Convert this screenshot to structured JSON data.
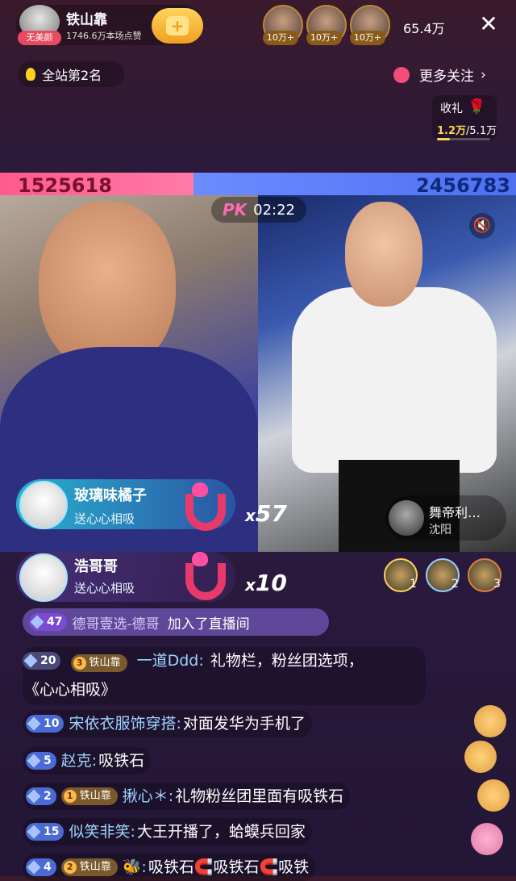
{
  "header": {
    "host_name": "铁山靠",
    "host_badge": "无美颜",
    "host_likes": "1746.6万本场点赞",
    "follow_symbol": "+",
    "top_fans": [
      {
        "label": "10万+"
      },
      {
        "label": "10万+"
      },
      {
        "label": "10万+"
      }
    ],
    "viewers": "65.4万",
    "close_symbol": "✕"
  },
  "subheader": {
    "rank_text": "全站第2名",
    "more_follow": "更多关注",
    "more_follow_arrow": "›",
    "gift_title": "收礼",
    "gift_current": "1.2万",
    "gift_target": "/5.1万"
  },
  "pk": {
    "left_score": "1525618",
    "right_score": "2456783",
    "logo": "PK",
    "timer": "02:22",
    "mute_symbol": "🔇"
  },
  "combos": [
    {
      "name": "玻璃味橘子",
      "action": "送心心相吸",
      "mult_prefix": "x",
      "mult": "57"
    },
    {
      "name": "浩哥哥",
      "action": "送心心相吸",
      "mult_prefix": "x",
      "mult": "10"
    }
  ],
  "remote_host": {
    "name": "舞帝利…",
    "city": "沈阳"
  },
  "ranking": [
    {
      "num": "1"
    },
    {
      "num": "2"
    },
    {
      "num": "3"
    }
  ],
  "join_message": {
    "level": "47",
    "user": "德哥壹选-德哥",
    "text": "加入了直播间"
  },
  "chat": [
    {
      "level": "20",
      "fan_num": "3",
      "fan_tag": "铁山靠",
      "user": "一道Ddd:",
      "msg_line1": "礼物栏，粉丝团选项，",
      "msg_line2": "《心心相吸》"
    },
    {
      "level": "10",
      "user": "宋依衣服饰穿搭:",
      "msg": "对面发华为手机了"
    },
    {
      "level": "5",
      "user": "赵克:",
      "msg": "吸铁石"
    },
    {
      "level": "2",
      "fan_num": "1",
      "fan_tag": "铁山靠",
      "user": "揪心＊:",
      "msg": "礼物粉丝团里面有吸铁石"
    },
    {
      "level": "15",
      "user": "似笑非笑:",
      "msg": "大王开播了，蛤蟆兵回家"
    },
    {
      "level": "4",
      "fan_num": "2",
      "fan_tag": "铁山靠",
      "user": "🐝:",
      "msg": "吸铁石🧲吸铁石🧲吸铁"
    }
  ],
  "colors": {
    "pk_left": "#ff5a8e",
    "pk_right": "#5a7cf0",
    "accent_gold": "#ffd35a",
    "username": "#9fd3ff"
  }
}
